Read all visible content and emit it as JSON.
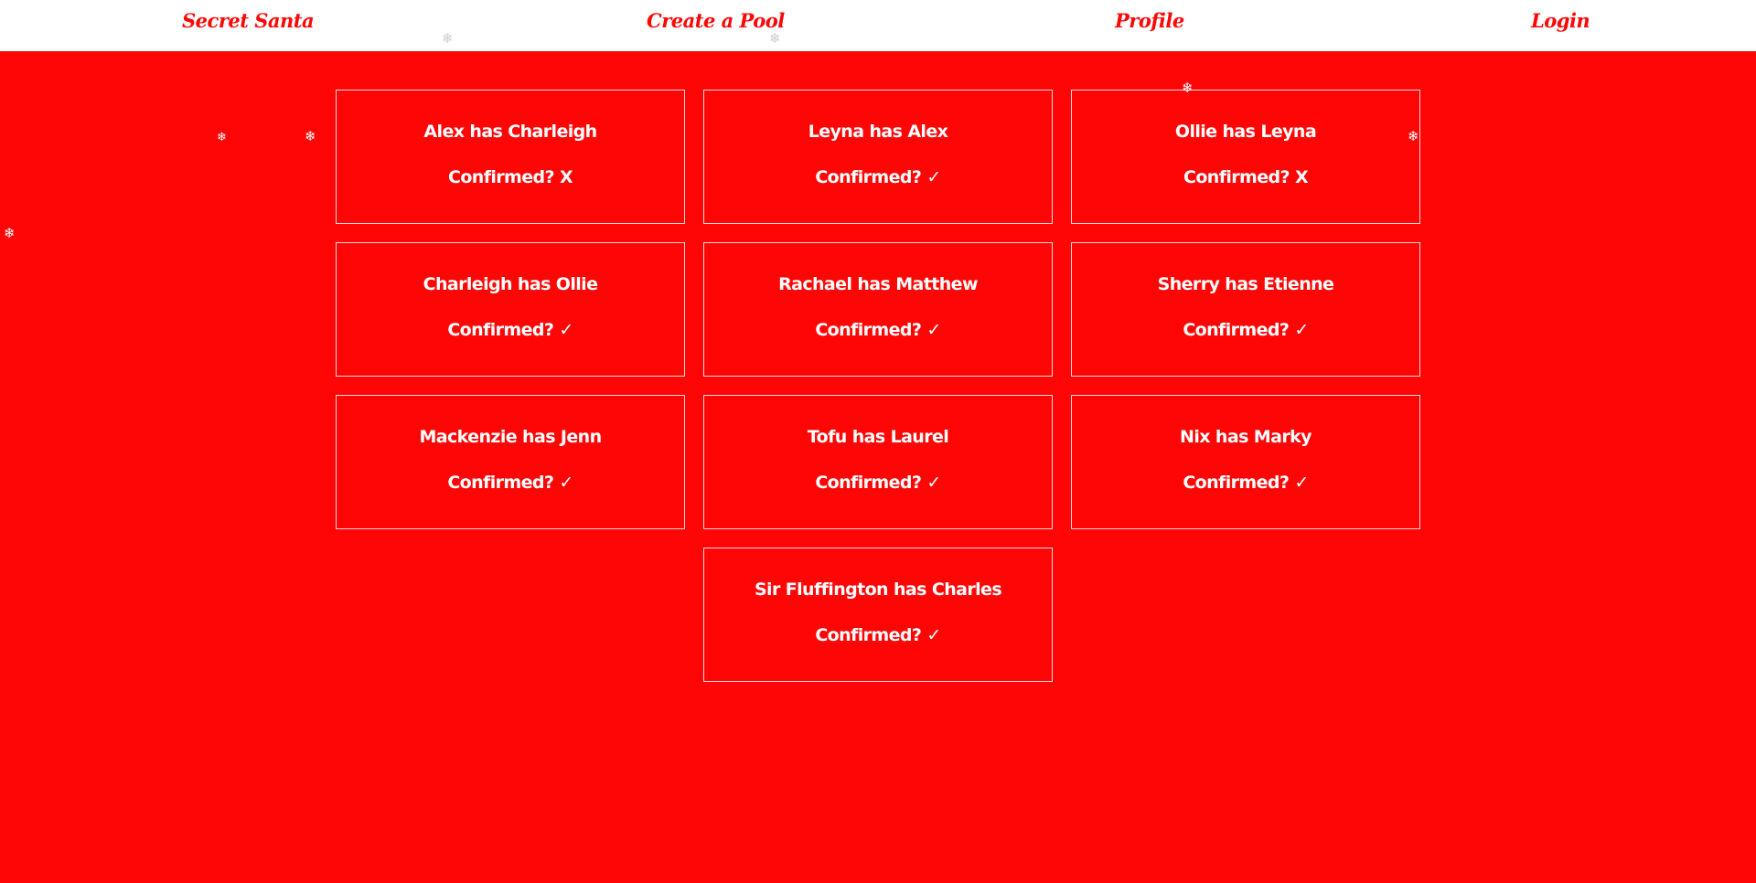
{
  "nav": {
    "brand": "Secret Santa",
    "create_pool": "Create a Pool",
    "profile": "Profile",
    "login": "Login"
  },
  "colors": {
    "background": "#ff0606",
    "nav_background": "#ffffff",
    "text": "#ffffff"
  },
  "confirmed_label": "Confirmed?",
  "assignments": [
    {
      "text": "Alex has Charleigh",
      "status": "X"
    },
    {
      "text": "Leyna has Alex",
      "status": "✓"
    },
    {
      "text": "Ollie has Leyna",
      "status": "X"
    },
    {
      "text": "Charleigh has Ollie",
      "status": "✓"
    },
    {
      "text": "Rachael has Matthew",
      "status": "✓"
    },
    {
      "text": "Sherry has Etienne",
      "status": "✓"
    },
    {
      "text": "Mackenzie has Jenn",
      "status": "✓"
    },
    {
      "text": "Tofu has Laurel",
      "status": "✓"
    },
    {
      "text": "Nix has Marky",
      "status": "✓"
    },
    {
      "text": "Sir Fluffington has Charles",
      "status": "✓"
    }
  ],
  "decor": {
    "snowflake_icon": "snowflake-icon",
    "glyph": "❄"
  }
}
